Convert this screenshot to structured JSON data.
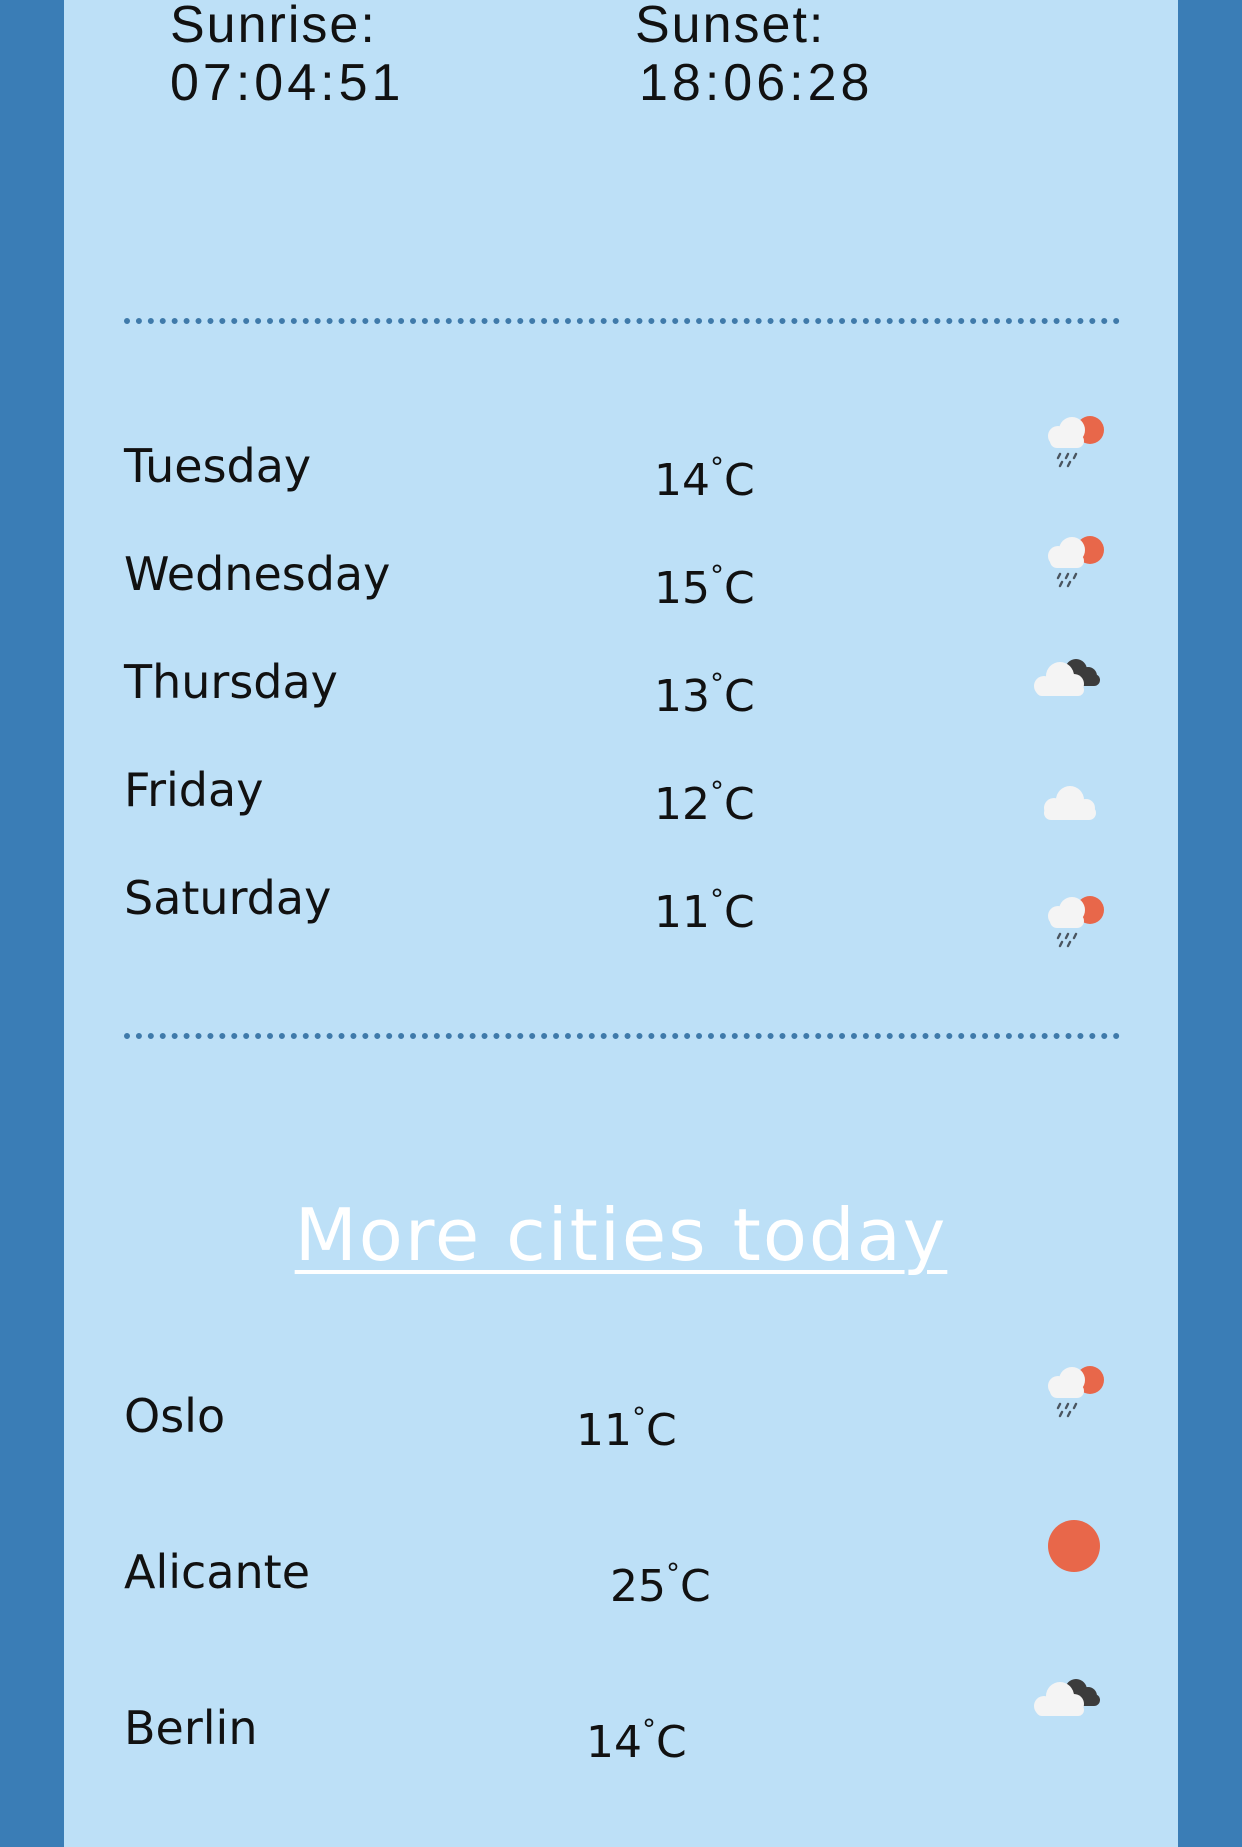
{
  "sun": {
    "sunrise_label": "Sunrise:",
    "sunrise_time": "07:04:51",
    "sunset_label": "Sunset:",
    "sunset_time": "18:06:28"
  },
  "forecast": [
    {
      "day": "Tuesday",
      "temp": "14",
      "unit": "C",
      "icon": "rain-sun-icon"
    },
    {
      "day": "Wednesday",
      "temp": "15",
      "unit": "C",
      "icon": "rain-sun-icon"
    },
    {
      "day": "Thursday",
      "temp": "13",
      "unit": "C",
      "icon": "dark-cloud-icon"
    },
    {
      "day": "Friday",
      "temp": "12",
      "unit": "C",
      "icon": "cloud-icon"
    },
    {
      "day": "Saturday",
      "temp": "11",
      "unit": "C",
      "icon": "rain-sun-icon"
    }
  ],
  "more_cities": {
    "link_label": "More cities today",
    "cities": [
      {
        "name": "Oslo",
        "temp": "11",
        "unit": "C",
        "icon": "rain-sun-icon"
      },
      {
        "name": "Alicante",
        "temp": "25",
        "unit": "C",
        "icon": "sun-icon"
      },
      {
        "name": "Berlin",
        "temp": "14",
        "unit": "C",
        "icon": "dark-cloud-icon"
      }
    ]
  },
  "colors": {
    "background": "#3a7db6",
    "panel": "#bde0f7",
    "divider": "#3f7aaa",
    "sun": "#e8674a",
    "cloud": "#f4f4f4",
    "dark_cloud": "#3c3c3c",
    "link": "#ffffff"
  }
}
